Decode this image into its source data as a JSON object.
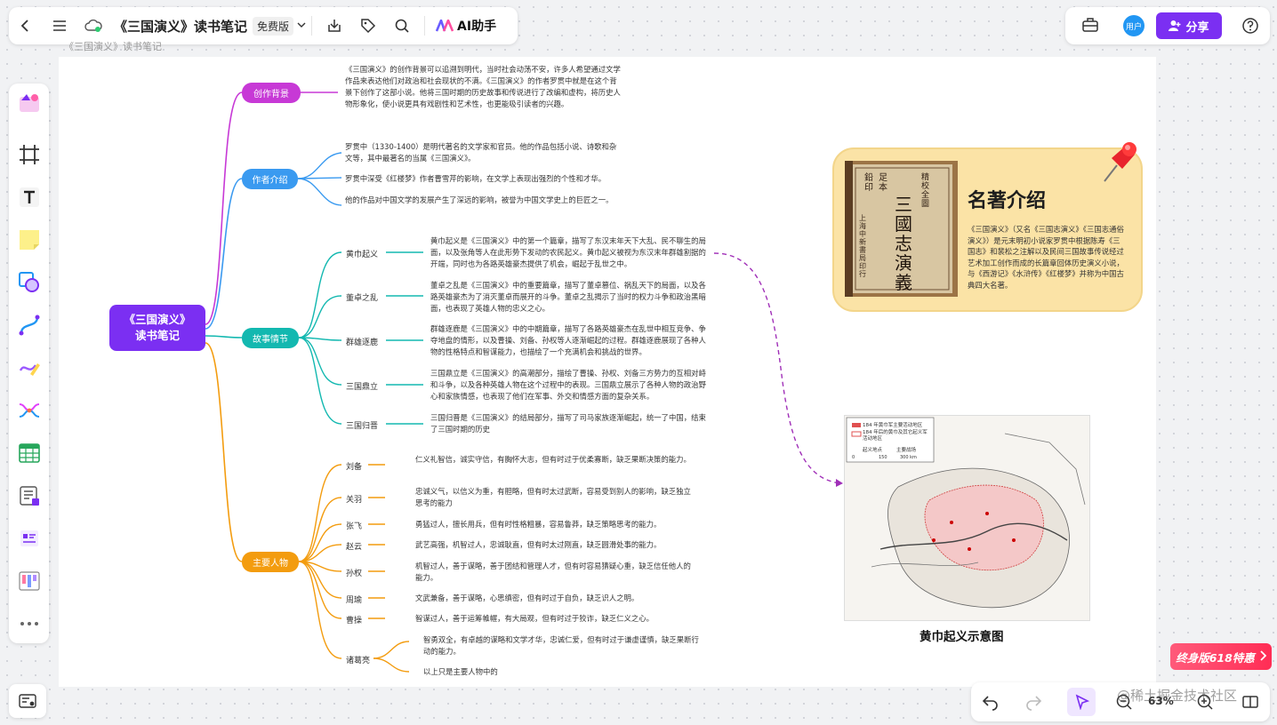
{
  "topbar": {
    "title": "《三国演义》读书笔记",
    "badge": "免费版",
    "ai_label": "AI助手"
  },
  "rightbar": {
    "avatar_text": "用户",
    "share_label": "分享"
  },
  "breadcrumb": "《三国演义》读书笔记",
  "mindmap": {
    "center_line1": "《三国演义》",
    "center_line2": "读书笔记",
    "branches": [
      {
        "label": "创作背景",
        "color": "#c739d6"
      },
      {
        "label": "作者介绍",
        "color": "#3a9af0"
      },
      {
        "label": "故事情节",
        "color": "#13b8b0"
      },
      {
        "label": "主要人物",
        "color": "#f39c0f"
      }
    ],
    "background_text": "《三国演义》的创作背景可以追溯到明代，当时社会动荡不安，许多人希望通过文学作品来表达他们对政治和社会现状的不满。《三国演义》的作者罗贯中就是在这个背景下创作了这部小说。他将三国时期的历史故事和传说进行了改编和虚构，将历史人物形象化，使小说更具有戏剧性和艺术性，也更能吸引读者的兴趣。",
    "author_texts": [
      "罗贯中（1330-1400）是明代著名的文学家和官员。他的作品包括小说、诗歌和杂文等，其中最著名的当属《三国演义》。",
      "罗贯中深受《红楼梦》作者曹雪芹的影响，在文学上表现出强烈的个性和才华。",
      "他的作品对中国文学的发展产生了深远的影响，被誉为中国文学史上的巨匠之一。"
    ],
    "plots": [
      {
        "name": "黄巾起义",
        "text": "黄巾起义是《三国演义》中的第一个篇章，描写了东汉末年天下大乱、民不聊生的局面，以及张角等人在此形势下发动的农民起义。黄巾起义被视为东汉末年群雄割据的开端，同时也为各路英雄豪杰提供了机会，崛起于乱世之中。"
      },
      {
        "name": "董卓之乱",
        "text": "董卓之乱是《三国演义》中的重要篇章，描写了董卓篡位、祸乱天下的局面，以及各路英雄豪杰为了消灭董卓而展开的斗争。董卓之乱揭示了当时的权力斗争和政治黑暗面，也表现了英雄人物的忠义之心。"
      },
      {
        "name": "群雄逐鹿",
        "text": "群雄逐鹿是《三国演义》中的中期篇章，描写了各路英雄豪杰在乱世中相互竞争、争夺地盘的情形，以及曹操、刘备、孙权等人逐渐崛起的过程。群雄逐鹿展现了各种人物的性格特点和智谋能力，也描绘了一个充满机会和挑战的世界。"
      },
      {
        "name": "三国鼎立",
        "text": "三国鼎立是《三国演义》的高潮部分，描绘了曹操、孙权、刘备三方势力的互相对峙和斗争，以及各种英雄人物在这个过程中的表现。三国鼎立展示了各种人物的政治野心和家族情感，也表现了他们在军事、外交和情感方面的复杂关系。"
      },
      {
        "name": "三国归晋",
        "text": "三国归晋是《三国演义》的结局部分，描写了司马家族逐渐崛起，统一了中国，结束了三国时期的历史"
      }
    ],
    "characters": [
      {
        "name": "刘备",
        "text": "仁义礼智信，诚实守信，有胸怀大志，但有时过于优柔寡断，缺乏果断决策的能力。"
      },
      {
        "name": "关羽",
        "text": "忠诚义气，以信义为重，有胆略，但有时太过武断，容易受到别人的影响，缺乏独立思考的能力"
      },
      {
        "name": "张飞",
        "text": "勇猛过人，擅长用兵，但有时性格粗暴，容易鲁莽，缺乏策略思考的能力。"
      },
      {
        "name": "赵云",
        "text": "武艺高强，机智过人，忠诚耿直，但有时太过刚直，缺乏圆滑处事的能力。"
      },
      {
        "name": "孙权",
        "text": "机智过人，善于谋略，善于团结和管理人才，但有时容易猜疑心重，缺乏信任他人的能力。"
      },
      {
        "name": "周瑜",
        "text": "文武兼备，善于谋略，心思缜密，但有时过于自负，缺乏识人之明。"
      },
      {
        "name": "曹操",
        "text": "智谋过人，善于运筹帷幄，有大局观，但有时过于狡诈，缺乏仁义之心。"
      },
      {
        "name": "诸葛亮",
        "text": "智勇双全，有卓越的谋略和文学才华，忠诚仁爱，但有时过于谦虚谨慎，缺乏果断行动的能力。",
        "extra": "以上只是主要人物中的"
      }
    ]
  },
  "card": {
    "title": "名著介绍",
    "text": "《三国演义》（又名《三国志演义》《三国志通俗演义》）是元末明初小说家罗贯中根据陈寿《三国志》和裴松之注解以及民间三国故事传说经过艺术加工创作而成的长篇章回体历史演义小说，与《西游记》《水浒传》《红楼梦》并称为中国古典四大名著。",
    "book_vertical": [
      "足本",
      "鉛印",
      "三國志演義",
      "精校全圖",
      "上海中新書局印行"
    ]
  },
  "map": {
    "caption": "黄巾起义示意图",
    "legend": [
      "184 年黄巾军主要活动地区",
      "184 年后的黄巾及其它起义军活动地区",
      "起义地点",
      "主要战场"
    ],
    "scale": [
      "0",
      "150",
      "300 km"
    ]
  },
  "bottom": {
    "zoom": "63%",
    "promo": "终身版618特惠",
    "watermark": "@稀土掘金技术社区"
  },
  "colors": {
    "accent": "#7b2ff2",
    "background_branch": "#c739d6",
    "author_branch": "#3a9af0",
    "plot_branch": "#13b8b0",
    "people_branch": "#f39c0f",
    "card_bg": "#fbe3a6"
  }
}
